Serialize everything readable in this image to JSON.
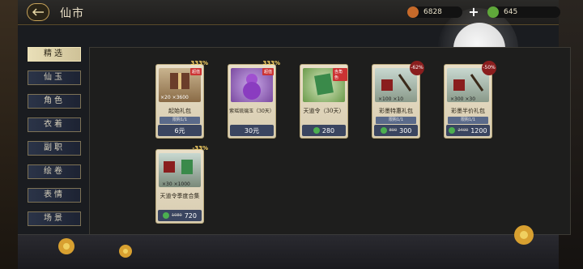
{
  "header": {
    "title": "仙市"
  },
  "currency": [
    {
      "icon": "copper-coin-icon",
      "value": "6828",
      "color": "#c76a2a"
    },
    {
      "icon": "jade-icon",
      "value": "645",
      "color": "#5fa83a"
    }
  ],
  "sidebar": {
    "items": [
      {
        "label": "精选",
        "active": true
      },
      {
        "label": "仙玉",
        "active": false
      },
      {
        "label": "角色",
        "active": false
      },
      {
        "label": "衣着",
        "active": false
      },
      {
        "label": "副职",
        "active": false
      },
      {
        "label": "绘卷",
        "active": false
      },
      {
        "label": "表情",
        "active": false
      },
      {
        "label": "场景",
        "active": false
      }
    ]
  },
  "cards": [
    {
      "name": "起始礼包",
      "limit": "限购1/1",
      "price": "6元",
      "old_price": "",
      "badge": "333%",
      "ribbon": "超值",
      "currency": ""
    },
    {
      "name": "紫瑶琉璃玉（30天）",
      "limit": "",
      "price": "30元",
      "old_price": "",
      "badge": "333%",
      "ribbon": "超值",
      "currency": ""
    },
    {
      "name": "天道令（30天）",
      "limit": "",
      "price": "280",
      "old_price": "",
      "badge": "",
      "ribbon": "含角色",
      "currency": "jade"
    },
    {
      "name": "彩墨特惠礼包",
      "limit": "限购1/1",
      "price": "300",
      "old_price": "800",
      "badge": "-62%",
      "ribbon": "",
      "currency": "jade"
    },
    {
      "name": "彩墨半价礼包",
      "limit": "限购1/1",
      "price": "1200",
      "old_price": "2400",
      "badge": "-50%",
      "ribbon": "",
      "currency": "jade"
    },
    {
      "name": "天道令季度合集",
      "limit": "",
      "price": "720",
      "old_price": "1080",
      "badge": "-33%",
      "ribbon": "",
      "currency": "jade"
    }
  ],
  "card_art_labels": {
    "c0": "×20 ×3600",
    "c3": "×100 ×10",
    "c4": "×300 ×30",
    "c5": "×30 ×1000"
  }
}
